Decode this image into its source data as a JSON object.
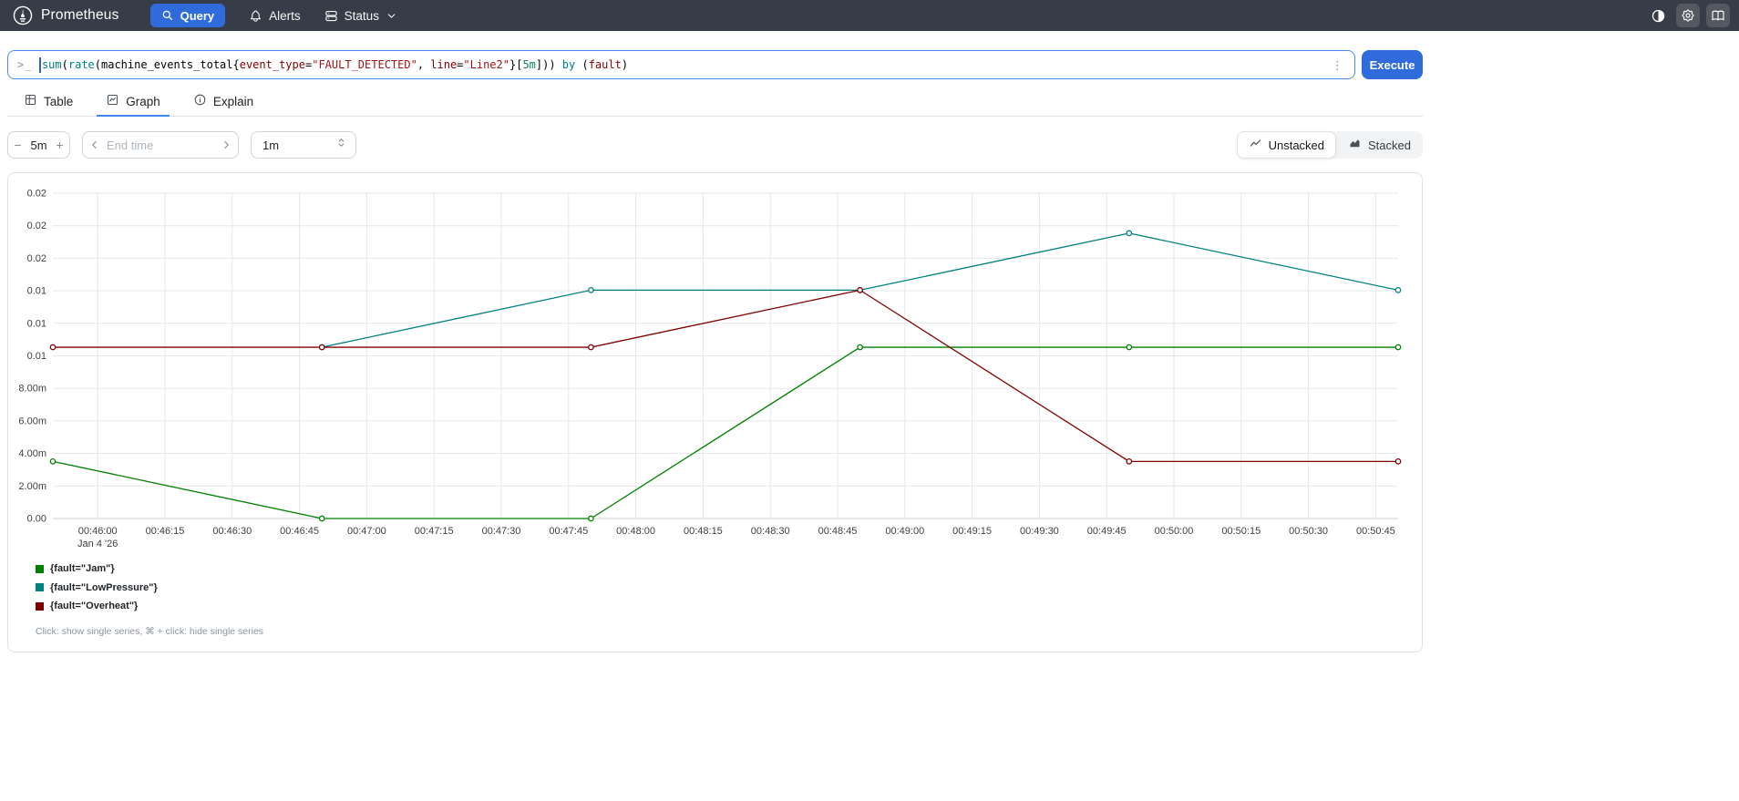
{
  "navbar": {
    "brand": "Prometheus",
    "items": {
      "query": "Query",
      "alerts": "Alerts",
      "status": "Status"
    },
    "colors": {
      "bg": "#373d48",
      "accent": "#2f6bdb"
    }
  },
  "query_bar": {
    "prompt": ">_",
    "menu_icon": "⋮",
    "execute_label": "Execute",
    "expression_plain": "sum(rate(machine_events_total{event_type=\"FAULT_DETECTED\", line=\"Line2\"}[5m])) by (fault)",
    "expression_segments": [
      {
        "text": "sum",
        "color": "#008080"
      },
      {
        "text": "("
      },
      {
        "text": "rate",
        "color": "#008080"
      },
      {
        "text": "(machine_events_total{"
      },
      {
        "text": "event_type",
        "color": "#800000"
      },
      {
        "text": "="
      },
      {
        "text": "\"FAULT_DETECTED\"",
        "color": "#a31515"
      },
      {
        "text": ", "
      },
      {
        "text": "line",
        "color": "#800000"
      },
      {
        "text": "="
      },
      {
        "text": "\"Line2\"",
        "color": "#a31515"
      },
      {
        "text": "}["
      },
      {
        "text": "5m",
        "color": "#09885a"
      },
      {
        "text": "])) "
      },
      {
        "text": "by",
        "color": "#008080"
      },
      {
        "text": " ("
      },
      {
        "text": "fault",
        "color": "#800000"
      },
      {
        "text": ")"
      }
    ]
  },
  "tabs": [
    {
      "label": "Table",
      "active": false
    },
    {
      "label": "Graph",
      "active": true
    },
    {
      "label": "Explain",
      "active": false
    }
  ],
  "controls": {
    "range": {
      "decrease_label": "−",
      "value": "5m",
      "increase_label": "+"
    },
    "end_time_placeholder": "End time",
    "resolution_value": "1m",
    "stacking": {
      "unstacked": "Unstacked",
      "stacked": "Stacked",
      "active": "Unstacked"
    }
  },
  "chart_data": {
    "type": "line",
    "grid": true,
    "legend_position": "bottom-left",
    "x_axis": {
      "domain_seconds": [
        0,
        300
      ],
      "tick_first_offset_s": 10,
      "tick_step_s": 15,
      "tick_labels": [
        "00:46:00",
        "00:46:15",
        "00:46:30",
        "00:46:45",
        "00:47:00",
        "00:47:15",
        "00:47:30",
        "00:47:45",
        "00:48:00",
        "00:48:15",
        "00:48:30",
        "00:48:45",
        "00:49:00",
        "00:49:15",
        "00:49:30",
        "00:49:45",
        "00:50:00",
        "00:50:15",
        "00:50:30",
        "00:50:45"
      ],
      "date_label": "Jan 4 '26"
    },
    "y_axis": {
      "ylim": [
        0,
        0.02
      ],
      "tick_step": 0.002,
      "tick_labels": [
        "0.00",
        "2.00m",
        "4.00m",
        "6.00m",
        "8.00m",
        "0.01",
        "0.01",
        "0.01",
        "0.02",
        "0.02",
        "0.02"
      ]
    },
    "sample_offsets_s": [
      0,
      60,
      120,
      180,
      240,
      300
    ],
    "sample_times": [
      "00:45:50",
      "00:46:50",
      "00:47:50",
      "00:48:50",
      "00:49:50",
      "00:50:50"
    ],
    "series": [
      {
        "name": "{fault=\"Jam\"}",
        "color": "#008000",
        "values": [
          0.00351,
          0,
          0,
          0.01053,
          0.01053,
          0.01053
        ]
      },
      {
        "name": "{fault=\"LowPressure\"}",
        "color": "#008080",
        "values": [
          null,
          0.01053,
          0.01404,
          0.01404,
          0.01754,
          0.01404
        ]
      },
      {
        "name": "{fault=\"Overheat\"}",
        "color": "#800000",
        "values": [
          0.01053,
          0.01053,
          0.01053,
          0.01404,
          0.00351,
          0.00351
        ]
      }
    ]
  },
  "graph_footer": {
    "hint": "Click: show single series, ⌘ + click: hide single series"
  }
}
